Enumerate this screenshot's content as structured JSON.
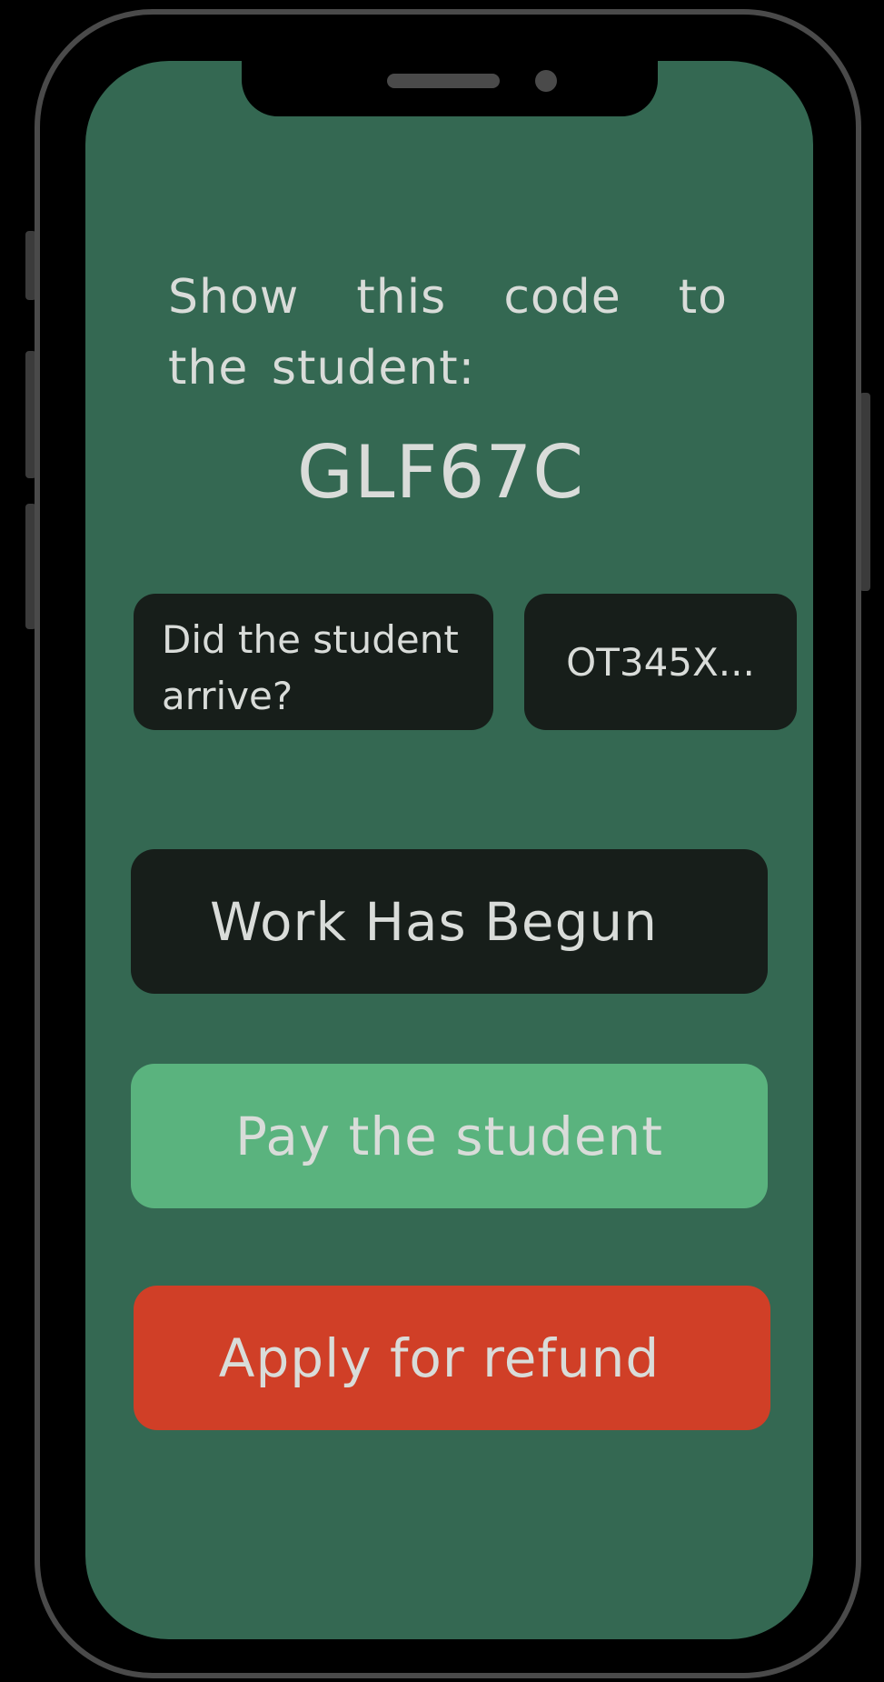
{
  "screen": {
    "instruction": "Show this code to the student:",
    "code": "GLF67C"
  },
  "arrival_card": {
    "question": "Did the student arrive?",
    "reference": "OT345X..."
  },
  "actions": {
    "work_begun_label": "Work Has Begun",
    "pay_label": "Pay the student",
    "refund_label": "Apply for refund"
  },
  "colors": {
    "screen_background": "#346852",
    "dark_card": "#171e1a",
    "pay_button": "#5ab37e",
    "refund_button": "#d03f27",
    "text": "#d9dcd9"
  }
}
